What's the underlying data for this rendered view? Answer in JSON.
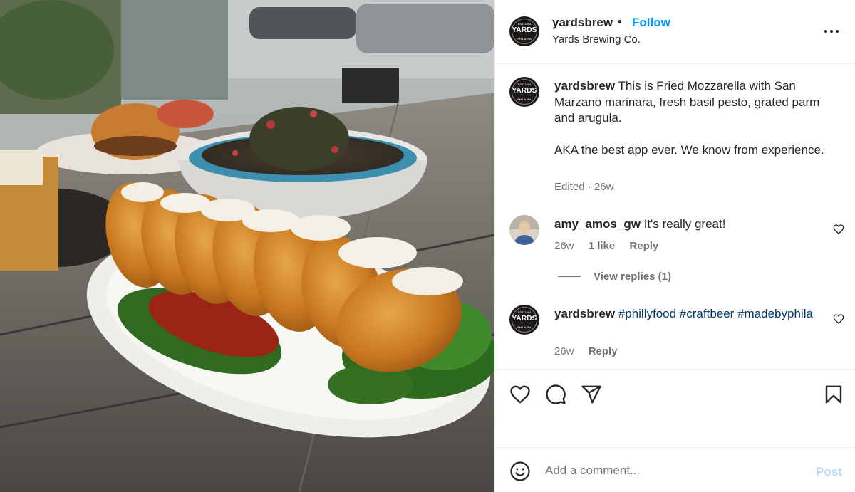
{
  "post": {
    "account": "yardsbrew",
    "separator": "•",
    "follow_label": "Follow",
    "subtitle": "Yards Brewing Co.",
    "avatar_brand": "YARDS",
    "avatar_top": "EST. 1994",
    "avatar_bottom": "PHILA. PA"
  },
  "caption": {
    "author": "yardsbrew",
    "text_1": "This is Fried Mozzarella with San Marzano marinara, fresh basil pesto, grated parm and arugula.",
    "text_2": "AKA the best app ever. We know from experience.",
    "edited": "Edited",
    "dot": "·",
    "age": "26w"
  },
  "comments": [
    {
      "author": "amy_amos_gw",
      "text": "It's really great!",
      "age": "26w",
      "likes": "1 like",
      "reply_label": "Reply",
      "view_replies": "View replies (1)"
    },
    {
      "author": "yardsbrew",
      "tags": [
        "#phillyfood",
        "#craftbeer",
        "#madebyphila"
      ],
      "age": "26w",
      "reply_label": "Reply"
    }
  ],
  "composer": {
    "placeholder": "Add a comment...",
    "post_label": "Post"
  },
  "icons": {
    "more": "more-icon",
    "like": "heart-icon",
    "comment": "comment-icon",
    "share": "send-icon",
    "save": "bookmark-icon",
    "emoji": "smile-icon"
  },
  "colors": {
    "link_blue": "#0095f6",
    "hashtag": "#00376b",
    "muted": "#737373",
    "post_disabled": "#b3dbff"
  }
}
